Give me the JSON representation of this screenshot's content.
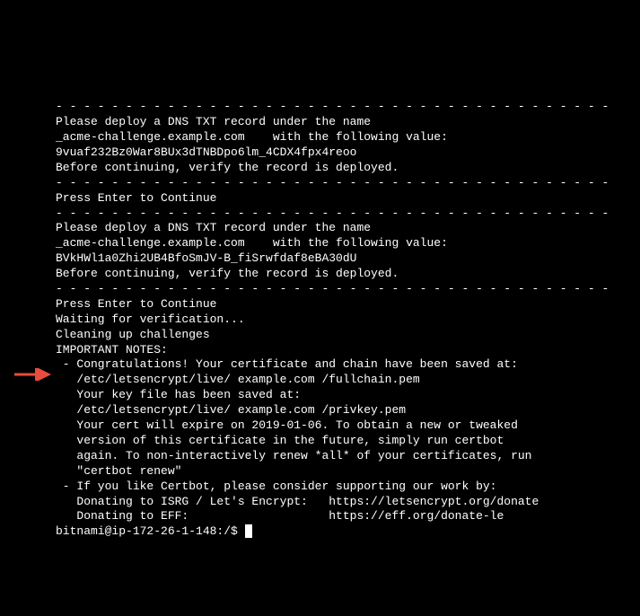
{
  "terminal": {
    "lines": [
      "- - - - - - - - - - - - - - - - - - - - - - - - - - - - - - - - - - - - - - - -",
      "Please deploy a DNS TXT record under the name",
      "_acme-challenge.example.com    with the following value:",
      "",
      "9vuaf232Bz0War8BUx3dTNBDpo6lm_4CDX4fpx4reoo",
      "",
      "Before continuing, verify the record is deployed.",
      "- - - - - - - - - - - - - - - - - - - - - - - - - - - - - - - - - - - - - - - -",
      "Press Enter to Continue",
      "",
      "- - - - - - - - - - - - - - - - - - - - - - - - - - - - - - - - - - - - - - - -",
      "Please deploy a DNS TXT record under the name",
      "_acme-challenge.example.com    with the following value:",
      "",
      "BVkHWl1a0Zhi2UB4BfoSmJV-B_fiSrwfdaf8eBA30dU",
      "",
      "Before continuing, verify the record is deployed.",
      "- - - - - - - - - - - - - - - - - - - - - - - - - - - - - - - - - - - - - - - -",
      "Press Enter to Continue",
      "Waiting for verification...",
      "Cleaning up challenges",
      "",
      "IMPORTANT NOTES:",
      " - Congratulations! Your certificate and chain have been saved at:",
      "   /etc/letsencrypt/live/ example.com /fullchain.pem",
      "   Your key file has been saved at:",
      "   /etc/letsencrypt/live/ example.com /privkey.pem",
      "   Your cert will expire on 2019-01-06. To obtain a new or tweaked",
      "   version of this certificate in the future, simply run certbot",
      "   again. To non-interactively renew *all* of your certificates, run",
      "   \"certbot renew\"",
      " - If you like Certbot, please consider supporting our work by:",
      "",
      "   Donating to ISRG / Let's Encrypt:   https://letsencrypt.org/donate",
      "   Donating to EFF:                    https://eff.org/donate-le",
      ""
    ],
    "prompt": "bitnami@ip-172-26-1-148:/$ "
  },
  "annotation": {
    "arrow_color": "#e74c3c"
  }
}
